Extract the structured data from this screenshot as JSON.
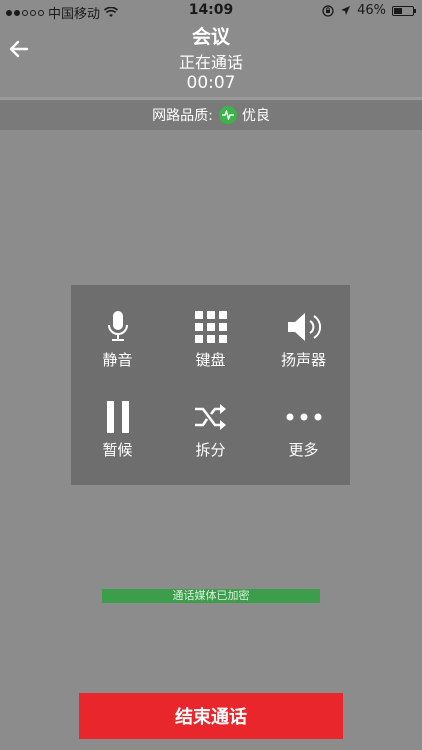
{
  "status_bar": {
    "carrier": "中国移动",
    "time": "14:09",
    "battery": "46%",
    "battery_level": 0.46
  },
  "header": {
    "title": "会议",
    "status": "正在通话",
    "duration": "00:07"
  },
  "network": {
    "label": "网路品质:",
    "quality": "优良",
    "indicator_color": "#3bb54a"
  },
  "controls": [
    {
      "label": "静音",
      "icon": "microphone-icon"
    },
    {
      "label": "键盘",
      "icon": "keypad-icon"
    },
    {
      "label": "扬声器",
      "icon": "speaker-icon"
    },
    {
      "label": "暂候",
      "icon": "pause-icon"
    },
    {
      "label": "拆分",
      "icon": "split-icon"
    },
    {
      "label": "更多",
      "icon": "more-icon"
    }
  ],
  "encryption": {
    "text": "通话媒体已加密"
  },
  "end_call": {
    "label": "结束通话",
    "color": "#e8262c"
  }
}
